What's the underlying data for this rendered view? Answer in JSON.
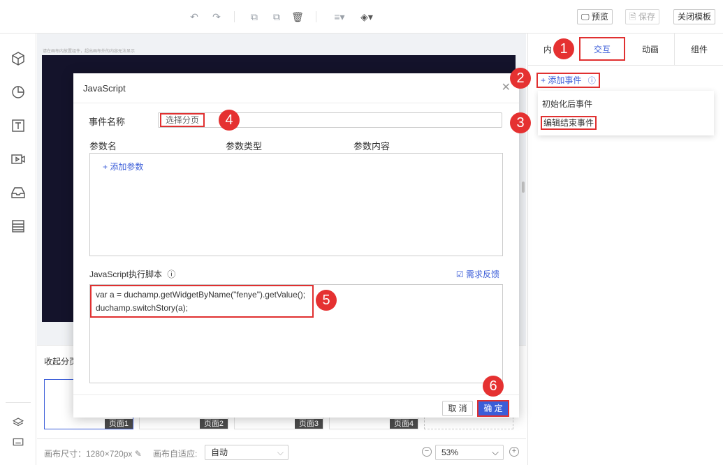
{
  "toolbar": {
    "icons": [
      "undo-icon",
      "redo-icon",
      "copy-icon",
      "paste-icon",
      "delete-icon",
      "align-icon",
      "layer-icon"
    ],
    "preview_label": "预览",
    "save_label": "保存",
    "close_template_label": "关闭模板"
  },
  "sidebar": {
    "icons": [
      "cube-icon",
      "pie-chart-icon",
      "text-icon",
      "video-icon",
      "inbox-icon",
      "table-icon",
      "layers-icon",
      "keyboard-icon"
    ]
  },
  "canvas": {
    "hint": "请在画布内放置组件，超出画布外的内容无法显示",
    "collapse_pages_label": "收起分页",
    "pages": [
      "页面1",
      "页面2",
      "页面3",
      "页面4"
    ]
  },
  "statusbar": {
    "canvas_size": "画布尺寸：1280×720px",
    "fit_label": "画布自适应:",
    "fit_value": "自动",
    "zoom_value": "53%"
  },
  "right_panel": {
    "tabs": [
      "内",
      "交互",
      "动画",
      "组件"
    ],
    "active_tab": "交互",
    "add_event_label": "+ 添加事件",
    "events": [
      "初始化后事件",
      "编辑结束事件"
    ]
  },
  "modal": {
    "title": "JavaScript",
    "event_name_label": "事件名称",
    "event_name_value": "选择分页",
    "param_headers": [
      "参数名",
      "参数类型",
      "参数内容"
    ],
    "add_param_label": "+ 添加参数",
    "js_label": "JavaScript执行脚本",
    "feedback_label": "需求反馈",
    "code_lines": [
      "var a = duchamp.getWidgetByName(\"fenye\").getValue();",
      "duchamp.switchStory(a);"
    ],
    "cancel_label": "取 消",
    "ok_label": "确 定"
  },
  "markers": [
    "1",
    "2",
    "3",
    "4",
    "5",
    "6"
  ],
  "colors": {
    "accent": "#3b5dd8",
    "highlight": "#e03030",
    "marker": "#e53131",
    "canvas_bg": "#14132b"
  }
}
